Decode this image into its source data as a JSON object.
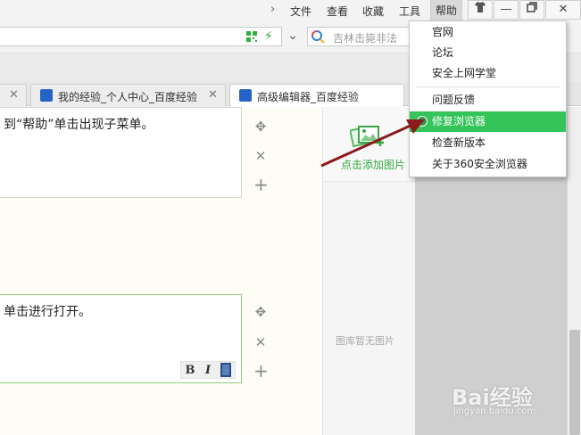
{
  "menubar": {
    "items": [
      "文件",
      "查看",
      "收藏",
      "工具",
      "帮助"
    ],
    "active": "帮助"
  },
  "address": {
    "search_placeholder": "吉林击毙非法"
  },
  "tabs": [
    {
      "label": "我的经验_个人中心_百度经验"
    },
    {
      "label": "高级编辑器_百度经验"
    }
  ],
  "editor": {
    "step1_text": "到“帮助”单击出现子菜单。",
    "step2_text": "单击进行打开。",
    "format_bold": "B",
    "format_italic": "I"
  },
  "image_panel": {
    "add_label": "点击添加图片",
    "empty_label": "图库暂无图片"
  },
  "help_menu": {
    "items": [
      "官网",
      "论坛",
      "安全上网学堂",
      "问题反馈",
      "修复浏览器",
      "检查新版本",
      "关于360安全浏览器"
    ],
    "highlighted": "修复浏览器"
  },
  "watermark": {
    "logo": "Bai经验",
    "url": "jingyan.baidu.com"
  },
  "colors": {
    "highlight": "#35c45a",
    "accent_green": "#2eaa3f",
    "arrow": "#8b1a1a"
  },
  "icons": {
    "qr": "qr-code-icon",
    "bolt": "lightning-icon",
    "search": "search-icon",
    "skin": "shirt-icon",
    "minimize": "minimize-icon",
    "restore": "restore-icon",
    "close": "close-icon"
  }
}
